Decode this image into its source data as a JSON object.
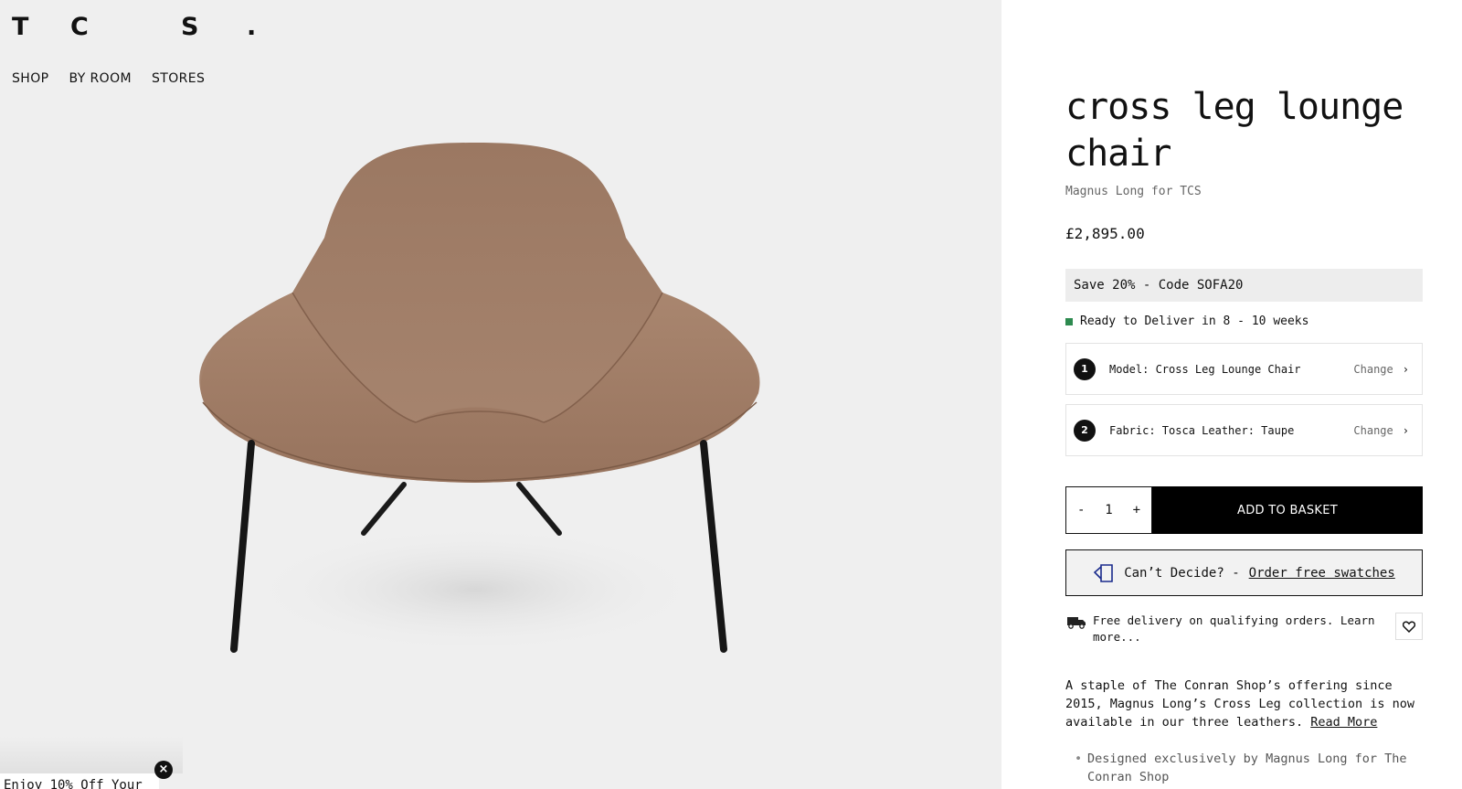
{
  "header": {
    "logo_letters": [
      "T",
      "C",
      "S",
      "."
    ],
    "nav": [
      "SHOP",
      "BY ROOM",
      "STORES"
    ]
  },
  "product": {
    "title": "cross leg lounge chair",
    "designer": "Magnus Long for TCS",
    "price": "£2,895.00",
    "promo": "Save 20% - Code SOFA20",
    "availability": "Ready to Deliver in 8 - 10 weeks",
    "availability_color": "#2d8a4f",
    "options": [
      {
        "num": "1",
        "label": "Model: Cross Leg Lounge Chair",
        "action": "Change"
      },
      {
        "num": "2",
        "label": "Fabric: Tosca Leather: Taupe",
        "action": "Change"
      }
    ],
    "quantity": {
      "minus": "-",
      "value": "1",
      "plus": "+"
    },
    "add_to_basket": "ADD TO BASKET",
    "swatch": {
      "prefix": "Can’t Decide? -",
      "link": "Order free swatches"
    },
    "delivery": "Free delivery on qualifying orders. Learn more...",
    "description": "A staple of The Conran Shop’s offering since 2015, Magnus Long’s Cross Leg collection is now available in our three leathers.",
    "read_more": "Read More",
    "bullets": [
      "Designed exclusively by Magnus Long for The Conran Shop"
    ]
  },
  "popup": {
    "text": "Enjoy 10% Off Your",
    "close_icon": "×"
  },
  "colors": {
    "gallery_bg": "#efefef",
    "chair_leather": "#a07d67",
    "button_bg": "#000000"
  }
}
